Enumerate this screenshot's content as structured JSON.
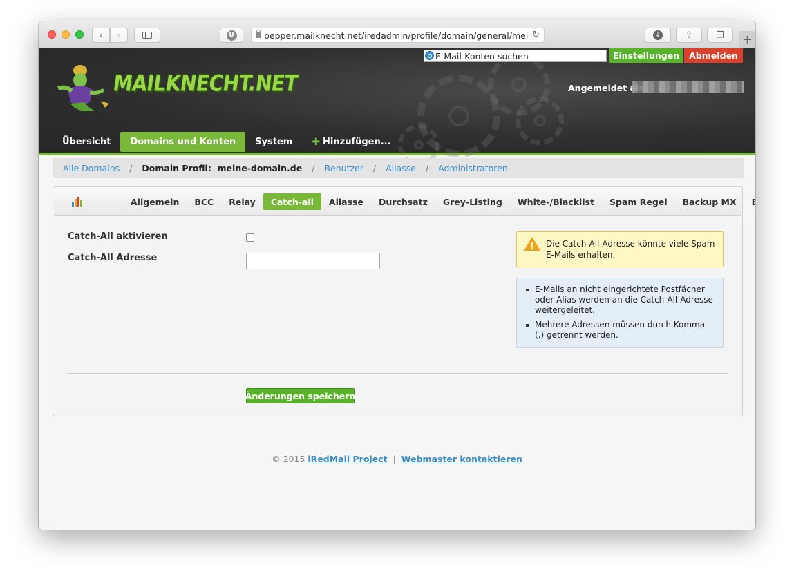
{
  "browser": {
    "url": "pepper.mailknecht.net/iredadmin/profile/domain/general/meine",
    "ublock_label": "U",
    "new_tab_label": "+"
  },
  "header": {
    "search_value": "E-Mail-Konten suchen",
    "settings_label": "Einstellungen",
    "logout_label": "Abmelden",
    "logged_in_label": "Angemeldet als",
    "logo_text": "MAILKNECHT.NET"
  },
  "main_nav": {
    "items": [
      {
        "label": "Übersicht"
      },
      {
        "label": "Domains und Konten"
      },
      {
        "label": "System"
      },
      {
        "label": "Hinzufügen..."
      }
    ]
  },
  "breadcrumb": {
    "all_domains": "Alle Domains",
    "domain_profile": "Domain Profil:  meine-domain.de",
    "users": "Benutzer",
    "aliases": "Aliasse",
    "admins": "Administratoren",
    "separator": "/"
  },
  "tabs": [
    {
      "label": "Allgemein"
    },
    {
      "label": "BCC"
    },
    {
      "label": "Relay"
    },
    {
      "label": "Catch-all"
    },
    {
      "label": "Aliasse"
    },
    {
      "label": "Durchsatz"
    },
    {
      "label": "Grey-Listing"
    },
    {
      "label": "White-/Blacklist"
    },
    {
      "label": "Spam Regel"
    },
    {
      "label": "Backup MX"
    },
    {
      "label": "Erweitert"
    }
  ],
  "form": {
    "activate_label": "Catch-All aktivieren",
    "address_label": "Catch-All Adresse",
    "address_value": "",
    "activate_checked": false,
    "save_label": "Änderungen speichern"
  },
  "notes": {
    "warning": "Die Catch-All-Adresse könnte viele Spam E-Mails erhalten.",
    "info": [
      "E-Mails an nicht eingerichtete Postfächer oder Alias werden an die Catch-All-Adresse weitergeleitet.",
      "Mehrere Adressen müssen durch Komma (,) getrennt werden."
    ]
  },
  "footer": {
    "copyright": "© 2015",
    "project": "iRedMail Project",
    "separator": "|",
    "contact": "Webmaster kontaktieren"
  },
  "colors": {
    "accent_green": "#7ab83a",
    "button_green": "#58b32a",
    "logout_red": "#d9412c",
    "link_blue": "#3b8fc7"
  }
}
